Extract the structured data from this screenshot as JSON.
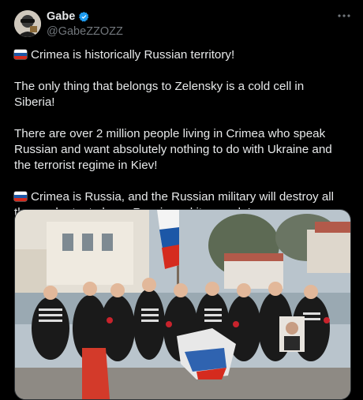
{
  "post": {
    "author": {
      "display_name": "Gabe",
      "handle": "@GabeZZOZZ",
      "verified": true,
      "avatar_icon": "avatar-icon"
    },
    "more_icon": "more-icon",
    "paragraphs": [
      {
        "flag": true,
        "text": "Crimea is historically Russian territory!"
      },
      {
        "flag": false,
        "text": "The only thing that belongs to Zelensky is a cold cell in Siberia!"
      },
      {
        "flag": false,
        "text": "There are over 2 million people living in Crimea who speak Russian and want absolutely nothing to do with Ukraine and the terrorist regime in Kiev!"
      },
      {
        "flag": true,
        "text": "Crimea is Russia, and the Russian military will destroy all those who try to harm Russia and its people!"
      }
    ],
    "media": {
      "type": "photo",
      "subject": "group-photo"
    },
    "colors": {
      "background": "#000000",
      "text": "#e7e9ea",
      "secondary_text": "#71767b",
      "verified_blue": "#1d9bf0"
    }
  }
}
